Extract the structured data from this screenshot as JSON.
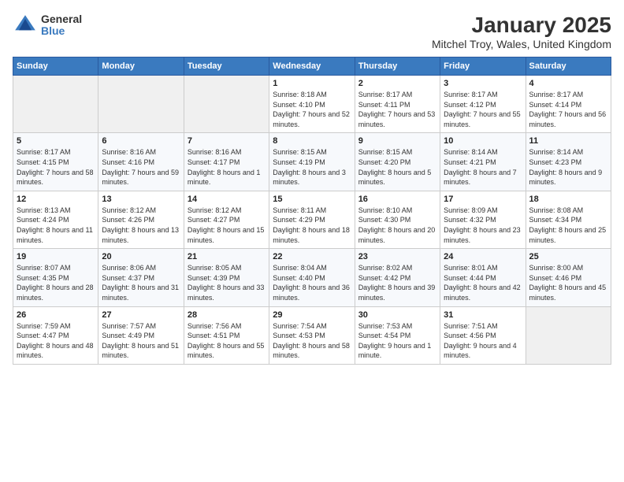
{
  "header": {
    "logo_general": "General",
    "logo_blue": "Blue",
    "title": "January 2025",
    "subtitle": "Mitchel Troy, Wales, United Kingdom"
  },
  "weekdays": [
    "Sunday",
    "Monday",
    "Tuesday",
    "Wednesday",
    "Thursday",
    "Friday",
    "Saturday"
  ],
  "weeks": [
    [
      {
        "day": "",
        "sunrise": "",
        "sunset": "",
        "daylight": ""
      },
      {
        "day": "",
        "sunrise": "",
        "sunset": "",
        "daylight": ""
      },
      {
        "day": "",
        "sunrise": "",
        "sunset": "",
        "daylight": ""
      },
      {
        "day": "1",
        "sunrise": "Sunrise: 8:18 AM",
        "sunset": "Sunset: 4:10 PM",
        "daylight": "Daylight: 7 hours and 52 minutes."
      },
      {
        "day": "2",
        "sunrise": "Sunrise: 8:17 AM",
        "sunset": "Sunset: 4:11 PM",
        "daylight": "Daylight: 7 hours and 53 minutes."
      },
      {
        "day": "3",
        "sunrise": "Sunrise: 8:17 AM",
        "sunset": "Sunset: 4:12 PM",
        "daylight": "Daylight: 7 hours and 55 minutes."
      },
      {
        "day": "4",
        "sunrise": "Sunrise: 8:17 AM",
        "sunset": "Sunset: 4:14 PM",
        "daylight": "Daylight: 7 hours and 56 minutes."
      }
    ],
    [
      {
        "day": "5",
        "sunrise": "Sunrise: 8:17 AM",
        "sunset": "Sunset: 4:15 PM",
        "daylight": "Daylight: 7 hours and 58 minutes."
      },
      {
        "day": "6",
        "sunrise": "Sunrise: 8:16 AM",
        "sunset": "Sunset: 4:16 PM",
        "daylight": "Daylight: 7 hours and 59 minutes."
      },
      {
        "day": "7",
        "sunrise": "Sunrise: 8:16 AM",
        "sunset": "Sunset: 4:17 PM",
        "daylight": "Daylight: 8 hours and 1 minute."
      },
      {
        "day": "8",
        "sunrise": "Sunrise: 8:15 AM",
        "sunset": "Sunset: 4:19 PM",
        "daylight": "Daylight: 8 hours and 3 minutes."
      },
      {
        "day": "9",
        "sunrise": "Sunrise: 8:15 AM",
        "sunset": "Sunset: 4:20 PM",
        "daylight": "Daylight: 8 hours and 5 minutes."
      },
      {
        "day": "10",
        "sunrise": "Sunrise: 8:14 AM",
        "sunset": "Sunset: 4:21 PM",
        "daylight": "Daylight: 8 hours and 7 minutes."
      },
      {
        "day": "11",
        "sunrise": "Sunrise: 8:14 AM",
        "sunset": "Sunset: 4:23 PM",
        "daylight": "Daylight: 8 hours and 9 minutes."
      }
    ],
    [
      {
        "day": "12",
        "sunrise": "Sunrise: 8:13 AM",
        "sunset": "Sunset: 4:24 PM",
        "daylight": "Daylight: 8 hours and 11 minutes."
      },
      {
        "day": "13",
        "sunrise": "Sunrise: 8:12 AM",
        "sunset": "Sunset: 4:26 PM",
        "daylight": "Daylight: 8 hours and 13 minutes."
      },
      {
        "day": "14",
        "sunrise": "Sunrise: 8:12 AM",
        "sunset": "Sunset: 4:27 PM",
        "daylight": "Daylight: 8 hours and 15 minutes."
      },
      {
        "day": "15",
        "sunrise": "Sunrise: 8:11 AM",
        "sunset": "Sunset: 4:29 PM",
        "daylight": "Daylight: 8 hours and 18 minutes."
      },
      {
        "day": "16",
        "sunrise": "Sunrise: 8:10 AM",
        "sunset": "Sunset: 4:30 PM",
        "daylight": "Daylight: 8 hours and 20 minutes."
      },
      {
        "day": "17",
        "sunrise": "Sunrise: 8:09 AM",
        "sunset": "Sunset: 4:32 PM",
        "daylight": "Daylight: 8 hours and 23 minutes."
      },
      {
        "day": "18",
        "sunrise": "Sunrise: 8:08 AM",
        "sunset": "Sunset: 4:34 PM",
        "daylight": "Daylight: 8 hours and 25 minutes."
      }
    ],
    [
      {
        "day": "19",
        "sunrise": "Sunrise: 8:07 AM",
        "sunset": "Sunset: 4:35 PM",
        "daylight": "Daylight: 8 hours and 28 minutes."
      },
      {
        "day": "20",
        "sunrise": "Sunrise: 8:06 AM",
        "sunset": "Sunset: 4:37 PM",
        "daylight": "Daylight: 8 hours and 31 minutes."
      },
      {
        "day": "21",
        "sunrise": "Sunrise: 8:05 AM",
        "sunset": "Sunset: 4:39 PM",
        "daylight": "Daylight: 8 hours and 33 minutes."
      },
      {
        "day": "22",
        "sunrise": "Sunrise: 8:04 AM",
        "sunset": "Sunset: 4:40 PM",
        "daylight": "Daylight: 8 hours and 36 minutes."
      },
      {
        "day": "23",
        "sunrise": "Sunrise: 8:02 AM",
        "sunset": "Sunset: 4:42 PM",
        "daylight": "Daylight: 8 hours and 39 minutes."
      },
      {
        "day": "24",
        "sunrise": "Sunrise: 8:01 AM",
        "sunset": "Sunset: 4:44 PM",
        "daylight": "Daylight: 8 hours and 42 minutes."
      },
      {
        "day": "25",
        "sunrise": "Sunrise: 8:00 AM",
        "sunset": "Sunset: 4:46 PM",
        "daylight": "Daylight: 8 hours and 45 minutes."
      }
    ],
    [
      {
        "day": "26",
        "sunrise": "Sunrise: 7:59 AM",
        "sunset": "Sunset: 4:47 PM",
        "daylight": "Daylight: 8 hours and 48 minutes."
      },
      {
        "day": "27",
        "sunrise": "Sunrise: 7:57 AM",
        "sunset": "Sunset: 4:49 PM",
        "daylight": "Daylight: 8 hours and 51 minutes."
      },
      {
        "day": "28",
        "sunrise": "Sunrise: 7:56 AM",
        "sunset": "Sunset: 4:51 PM",
        "daylight": "Daylight: 8 hours and 55 minutes."
      },
      {
        "day": "29",
        "sunrise": "Sunrise: 7:54 AM",
        "sunset": "Sunset: 4:53 PM",
        "daylight": "Daylight: 8 hours and 58 minutes."
      },
      {
        "day": "30",
        "sunrise": "Sunrise: 7:53 AM",
        "sunset": "Sunset: 4:54 PM",
        "daylight": "Daylight: 9 hours and 1 minute."
      },
      {
        "day": "31",
        "sunrise": "Sunrise: 7:51 AM",
        "sunset": "Sunset: 4:56 PM",
        "daylight": "Daylight: 9 hours and 4 minutes."
      },
      {
        "day": "",
        "sunrise": "",
        "sunset": "",
        "daylight": ""
      }
    ]
  ]
}
